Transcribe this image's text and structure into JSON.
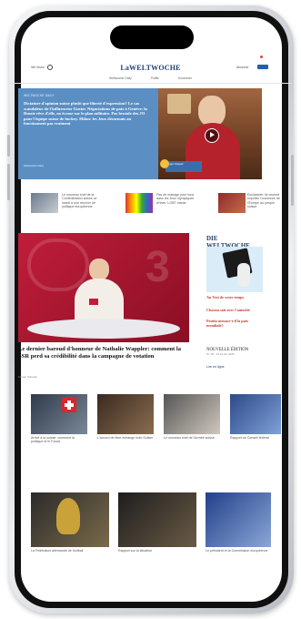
{
  "header": {
    "left_menu": "Wir lesen",
    "logo": "LaWELTWOCHE",
    "right_action": "Abonner",
    "nav": [
      "Weltwoche Daily",
      "Politik",
      "Kolumnen"
    ]
  },
  "hero": {
    "kicker": "WELTWOCHE DAILY",
    "headline": "Dictature d'opinion suisse plutôt que liberté d'expression? Le cas scandaleux de l'influenceur Guster. Négociations de paix à Genève: la Russie rêve d'elle, on écrase sur le plan militaire. Pas brutale des JO pour l'équipe suisse de hockey. Milan: les Jeux désormais au fonctionnent pas vraiment",
    "foot": "Weltwoche Daily",
    "caption": "Roger Köppel"
  },
  "mini_stories": [
    {
      "text": "Le nouveau chef de la Confédération suisse ce mardi à une réunion de politique européenne"
    },
    {
      "text": "Pas de mariage pour tous dans les Jeux olympiques d'hiver, LGBT mania"
    },
    {
      "text": "Exclusivité: ils veulent exporter l'ouverture de l'Europe au peuple suisse"
    }
  ],
  "main_story": {
    "title": "Le dernier baroud d'honneur de Nathalie Wappler: comment la SSR perd sa crédibilité dans la campagne de votation",
    "meta": "Florian Schwab"
  },
  "magazine": {
    "logo": "DIE WELTWOCHE",
    "red1": "Au Vest de votre temps",
    "red2": "Chacun sait avec l'autorité",
    "red3": "Poutin menace-t-il la paix mondiale?",
    "new_edition": "NOUVELLE ÉDITION",
    "new_sub": "Nr. 08 · 19 février 2026",
    "link": "Lire en ligne"
  },
  "grid": [
    {
      "text": "Arrivé à la suisse: comment la politique et le Fonds"
    },
    {
      "text": "L'accord de libre-échange Inde-Suisse"
    },
    {
      "text": "Le nouveau chef de l'Armée suisse"
    },
    {
      "text": "Rapport du Conseil fédéral"
    }
  ],
  "bottom": [
    {
      "text": "La Fédération allemande de football"
    },
    {
      "text": "Rapport sur la situation"
    },
    {
      "text": "Le président et la Commission européenne"
    }
  ],
  "colors": {
    "brand": "#1f3d6b",
    "hero_bg": "#5b8fc4",
    "main_bg": "#b01a33",
    "accent_red": "#c0392b"
  }
}
